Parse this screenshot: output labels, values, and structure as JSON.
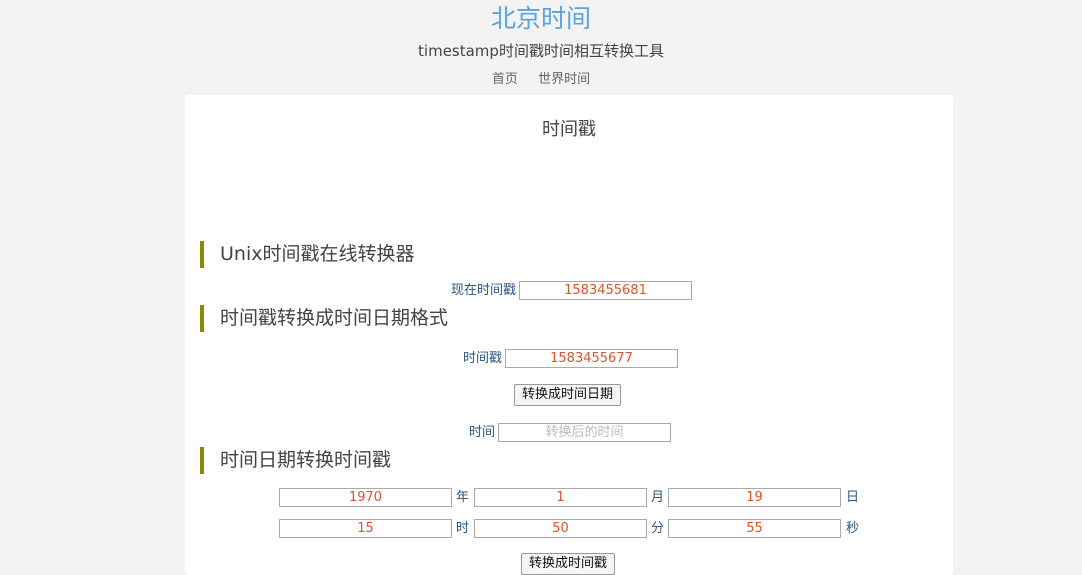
{
  "header": {
    "title": "北京时间",
    "subtitle": "timestamp时间戳时间相互转换工具",
    "nav": [
      "首页",
      "世界时间"
    ]
  },
  "panel": {
    "title": "时间戳"
  },
  "section_unix": {
    "heading": "Unix时间戳在线转换器",
    "now_label": "现在时间戳",
    "now_value": "1583455681"
  },
  "section_ts_to_date": {
    "heading": "时间戳转换成时间日期格式",
    "ts_label": "时间戳",
    "ts_value": "1583455677",
    "button": "转换成时间日期",
    "result_label": "时间",
    "result_placeholder": "转换后的时间"
  },
  "section_date_to_ts": {
    "heading": "时间日期转换时间戳",
    "year": "1970",
    "year_unit": "年",
    "month": "1",
    "month_unit": "月",
    "day": "19",
    "day_unit": "日",
    "hour": "15",
    "hour_unit": "时",
    "minute": "50",
    "minute_unit": "分",
    "second": "55",
    "second_unit": "秒",
    "button": "转换成时间戳"
  }
}
